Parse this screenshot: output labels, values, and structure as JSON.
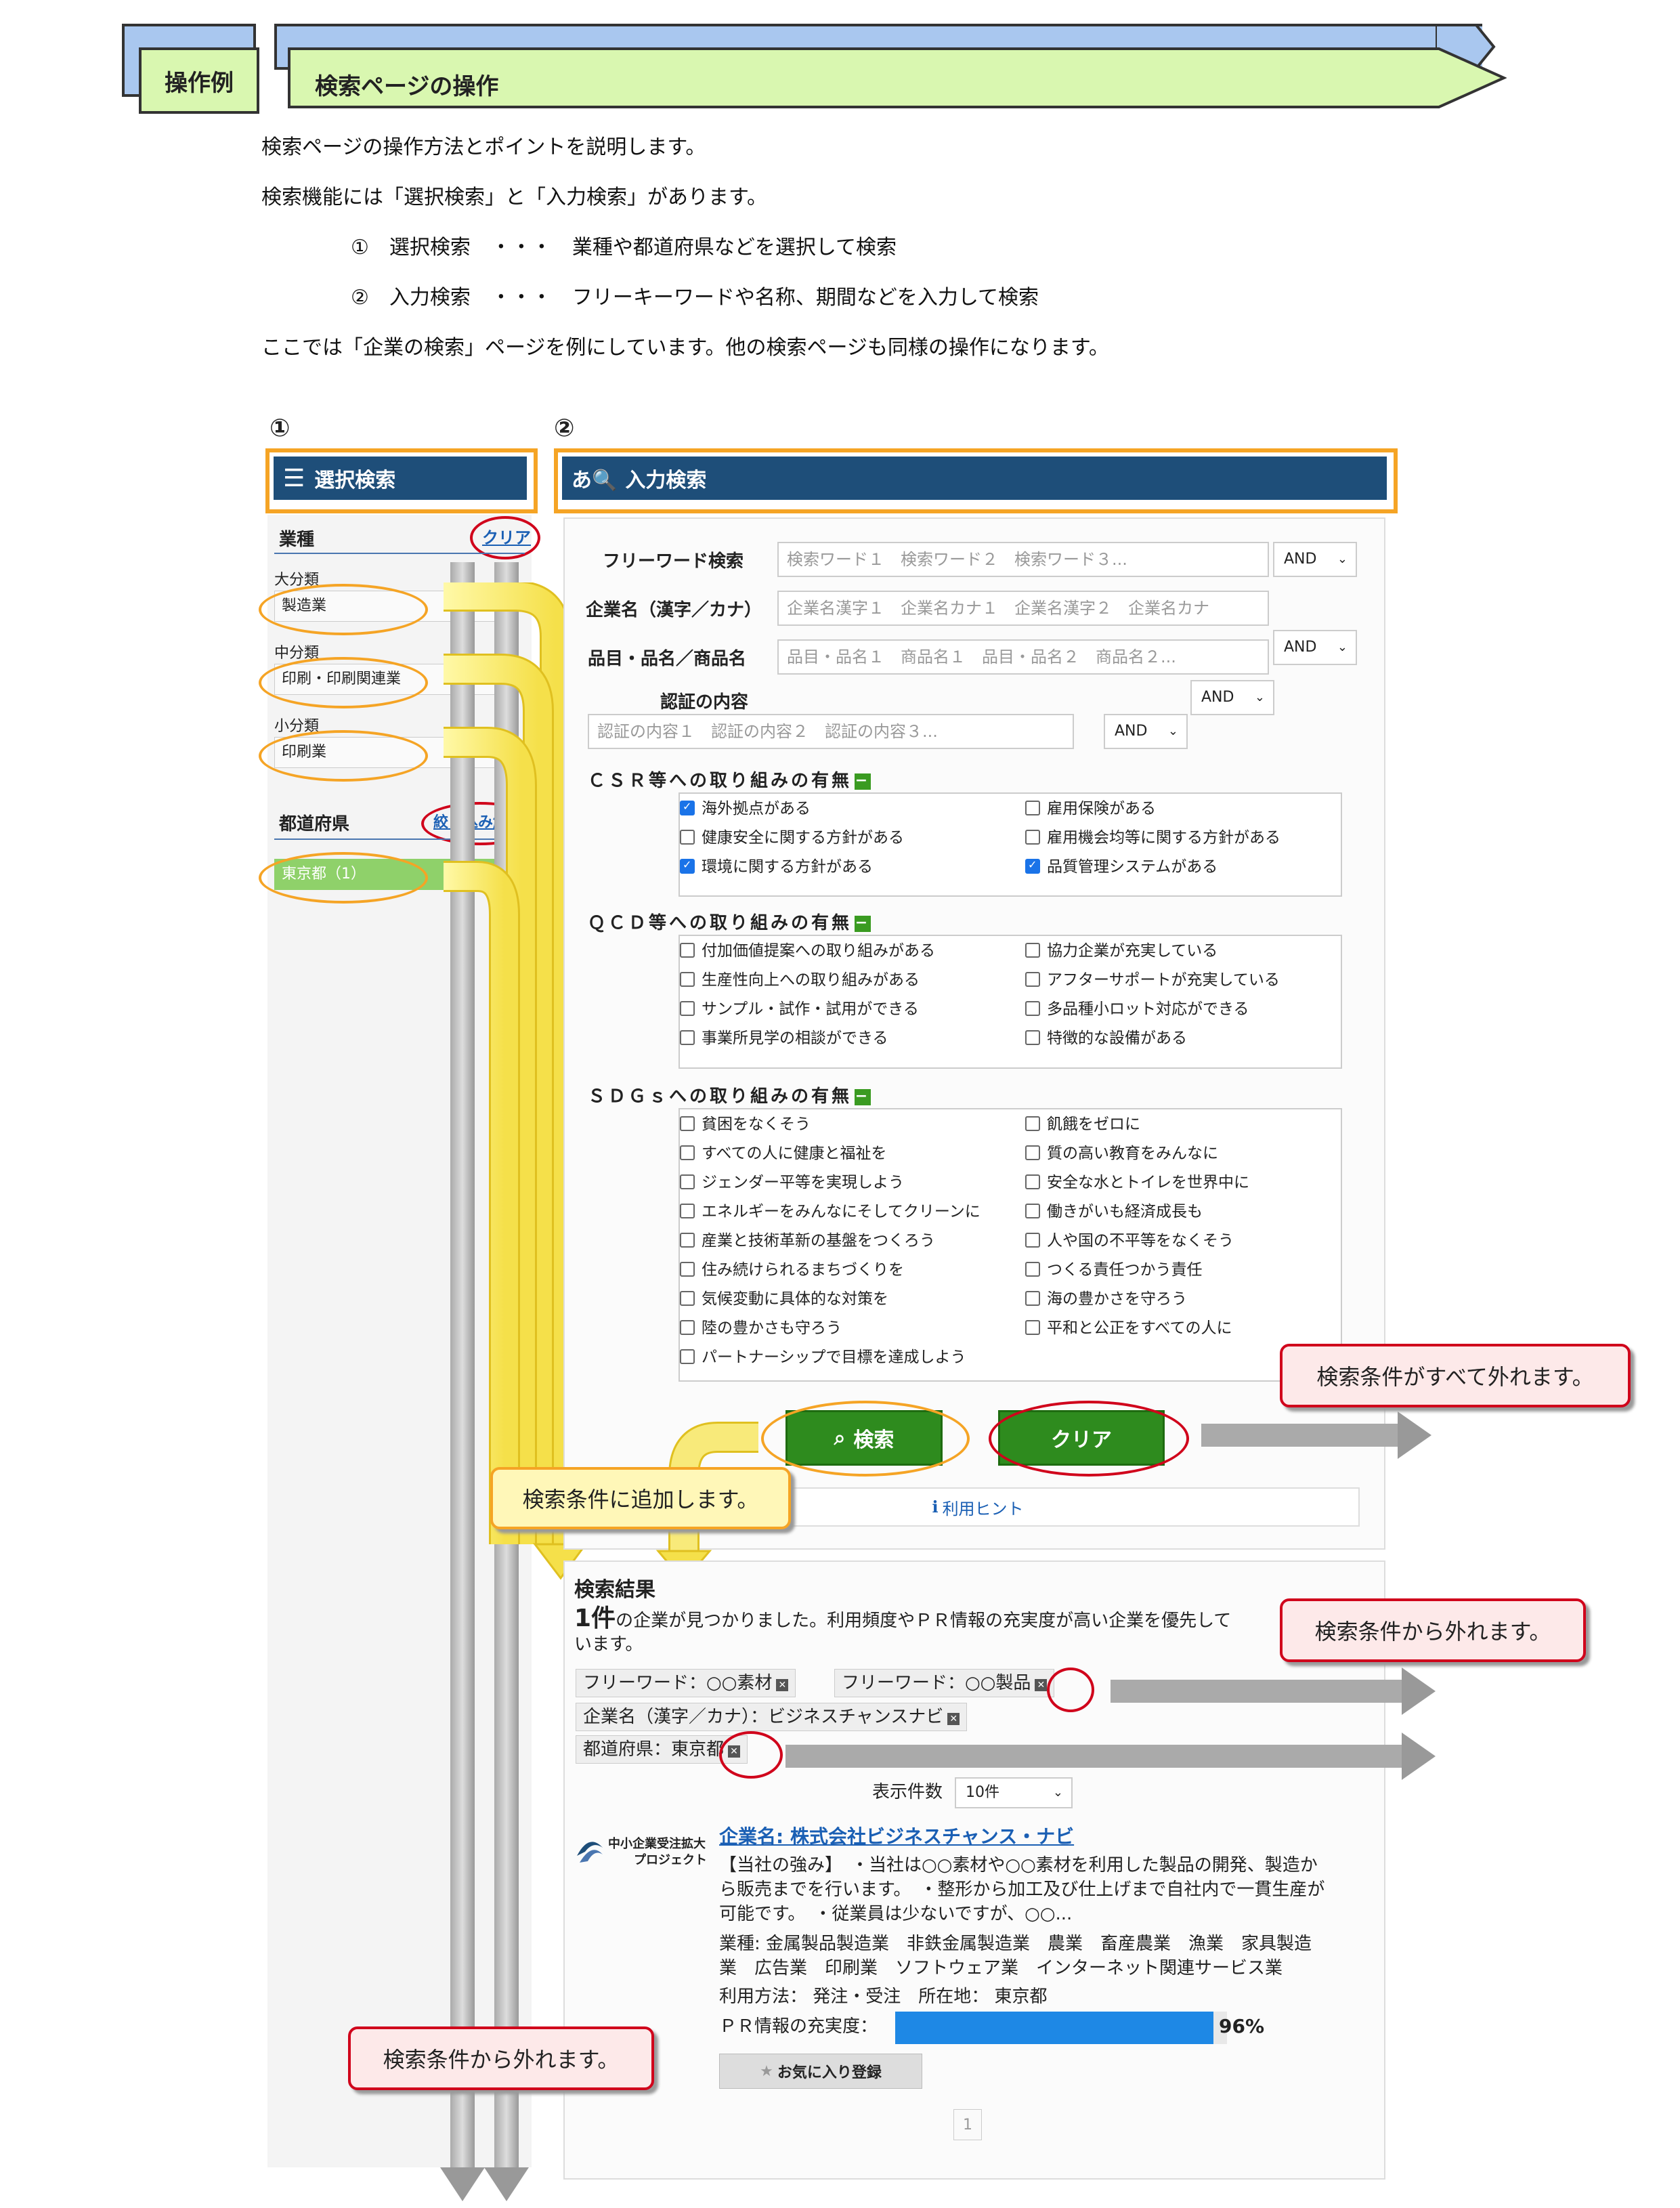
{
  "header": {
    "tab_label": "操作例",
    "title": "検索ページの操作"
  },
  "intro": {
    "line1": "検索ページの操作方法とポイントを説明します。",
    "line2": "検索機能には「選択検索」と「入力検索」があります。",
    "item1": "①　選択検索　・・・　業種や都道府県などを選択して検索",
    "item2": "②　入力検索　・・・　フリーキーワードや名称、期間などを入力して検索",
    "line3": "ここでは「企業の検索」ページを例にしています。他の検索ページも同様の操作になります。"
  },
  "markers": {
    "one": "①",
    "two": "②"
  },
  "select_search": {
    "title": "選択検索",
    "industry_label": "業種",
    "clear_link": "クリア",
    "major_label": "大分類",
    "major_value": "製造業",
    "middle_label": "中分類",
    "middle_value": "印刷・印刷関連業",
    "minor_label": "小分類",
    "minor_value": "印刷業",
    "pref_label": "都道府県",
    "pref_clear_link": "絞り込み解除",
    "pref_value": "東京都（1）"
  },
  "input_search": {
    "title": "入力検索",
    "free_word_label": "フリーワード検索",
    "free_word_placeholder": "検索ワード１　検索ワード２　検索ワード３...",
    "company_label": "企業名（漢字／カナ）",
    "company_placeholder": "企業名漢字１　企業名カナ１　企業名漢字２　企業名カナ",
    "product_label": "品目・品名／商品名",
    "product_placeholder": "品目・品名１　商品名１　品目・品名２　商品名２...",
    "cert_label": "認証の内容",
    "cert_placeholder": "認証の内容１　認証の内容２　認証の内容３...",
    "and": "AND",
    "csr_title": "ＣＳＲ等への取り組みの有無",
    "csr_items": [
      "海外拠点がある",
      "雇用保険がある",
      "健康安全に関する方針がある",
      "雇用機会均等に関する方針がある",
      "環境に関する方針がある",
      "品質管理システムがある"
    ],
    "qcd_title": "ＱＣＤ等への取り組みの有無",
    "qcd_items": [
      "付加価値提案への取り組みがある",
      "協力企業が充実している",
      "生産性向上への取り組みがある",
      "アフターサポートが充実している",
      "サンプル・試作・試用ができる",
      "多品種小ロット対応ができる",
      "事業所見学の相談ができる",
      "特徴的な設備がある"
    ],
    "sdgs_title": "ＳＤＧｓへの取り組みの有無",
    "sdgs_items": [
      "貧困をなくそう",
      "飢餓をゼロに",
      "すべての人に健康と福祉を",
      "質の高い教育をみんなに",
      "ジェンダー平等を実現しよう",
      "安全な水とトイレを世界中に",
      "エネルギーをみんなにそしてクリーンに",
      "働きがいも経済成長も",
      "産業と技術革新の基盤をつくろう",
      "人や国の不平等をなくそう",
      "住み続けられるまちづくりを",
      "つくる責任つかう責任",
      "気候変動に具体的な対策を",
      "海の豊かさを守ろう",
      "陸の豊かさも守ろう",
      "平和と公正をすべての人に",
      "パートナーシップで目標を達成しよう"
    ],
    "search_button": "検索",
    "clear_button": "クリア",
    "hint_link": "利用ヒント"
  },
  "callouts": {
    "clear_all": "検索条件がすべて外れます。",
    "add": "検索条件に追加します。",
    "remove_right": "検索条件から外れます。",
    "remove_left": "検索条件から外れます。"
  },
  "results": {
    "title": "検索結果",
    "count": "1件",
    "count_text": "の企業が見つかりました。利用頻度やＰＲ情報の充実度が高い企業を優先して",
    "count_text2": "います。",
    "tags": [
      "フリーワード：○○素材",
      "フリーワード：○○製品",
      "企業名（漢字／カナ）：ビジネスチャンスナビ",
      "都道府県：東京都"
    ],
    "per_page_label": "表示件数",
    "per_page_value": "10件",
    "logo_line1": "中小企業受注拡大",
    "logo_line2": "プロジェクト",
    "company_link": "企業名: 株式会社ビジネスチャンス・ナビ",
    "strength_1": "【当社の強み】　・当社は○○素材や○○素材を利用した製品の開発、製造か",
    "strength_2": "ら販売までを行います。　・整形から加工及び仕上げまで自社内で一貫生産が",
    "strength_3": "可能です。　・従業員は少ないですが、○○...",
    "industry_1": "業種: 金属製品製造業　非鉄金属製造業　農業　畜産農業　漁業　家具製造",
    "industry_2": "業　広告業　印刷業　ソフトウェア業　インターネット関連サービス業",
    "usage": "利用方法：  発注・受注　所在地：  東京都",
    "pr_label": "ＰＲ情報の充実度：",
    "pr_value": "96%",
    "pr_fraction": 0.96,
    "favorite_button": "お気に入り登録",
    "page_number": "1"
  },
  "colors": {
    "accent_orange": "#f5a425",
    "header_blue": "#1e4e79",
    "green": "#2e8b1e",
    "red": "#d0021b"
  }
}
